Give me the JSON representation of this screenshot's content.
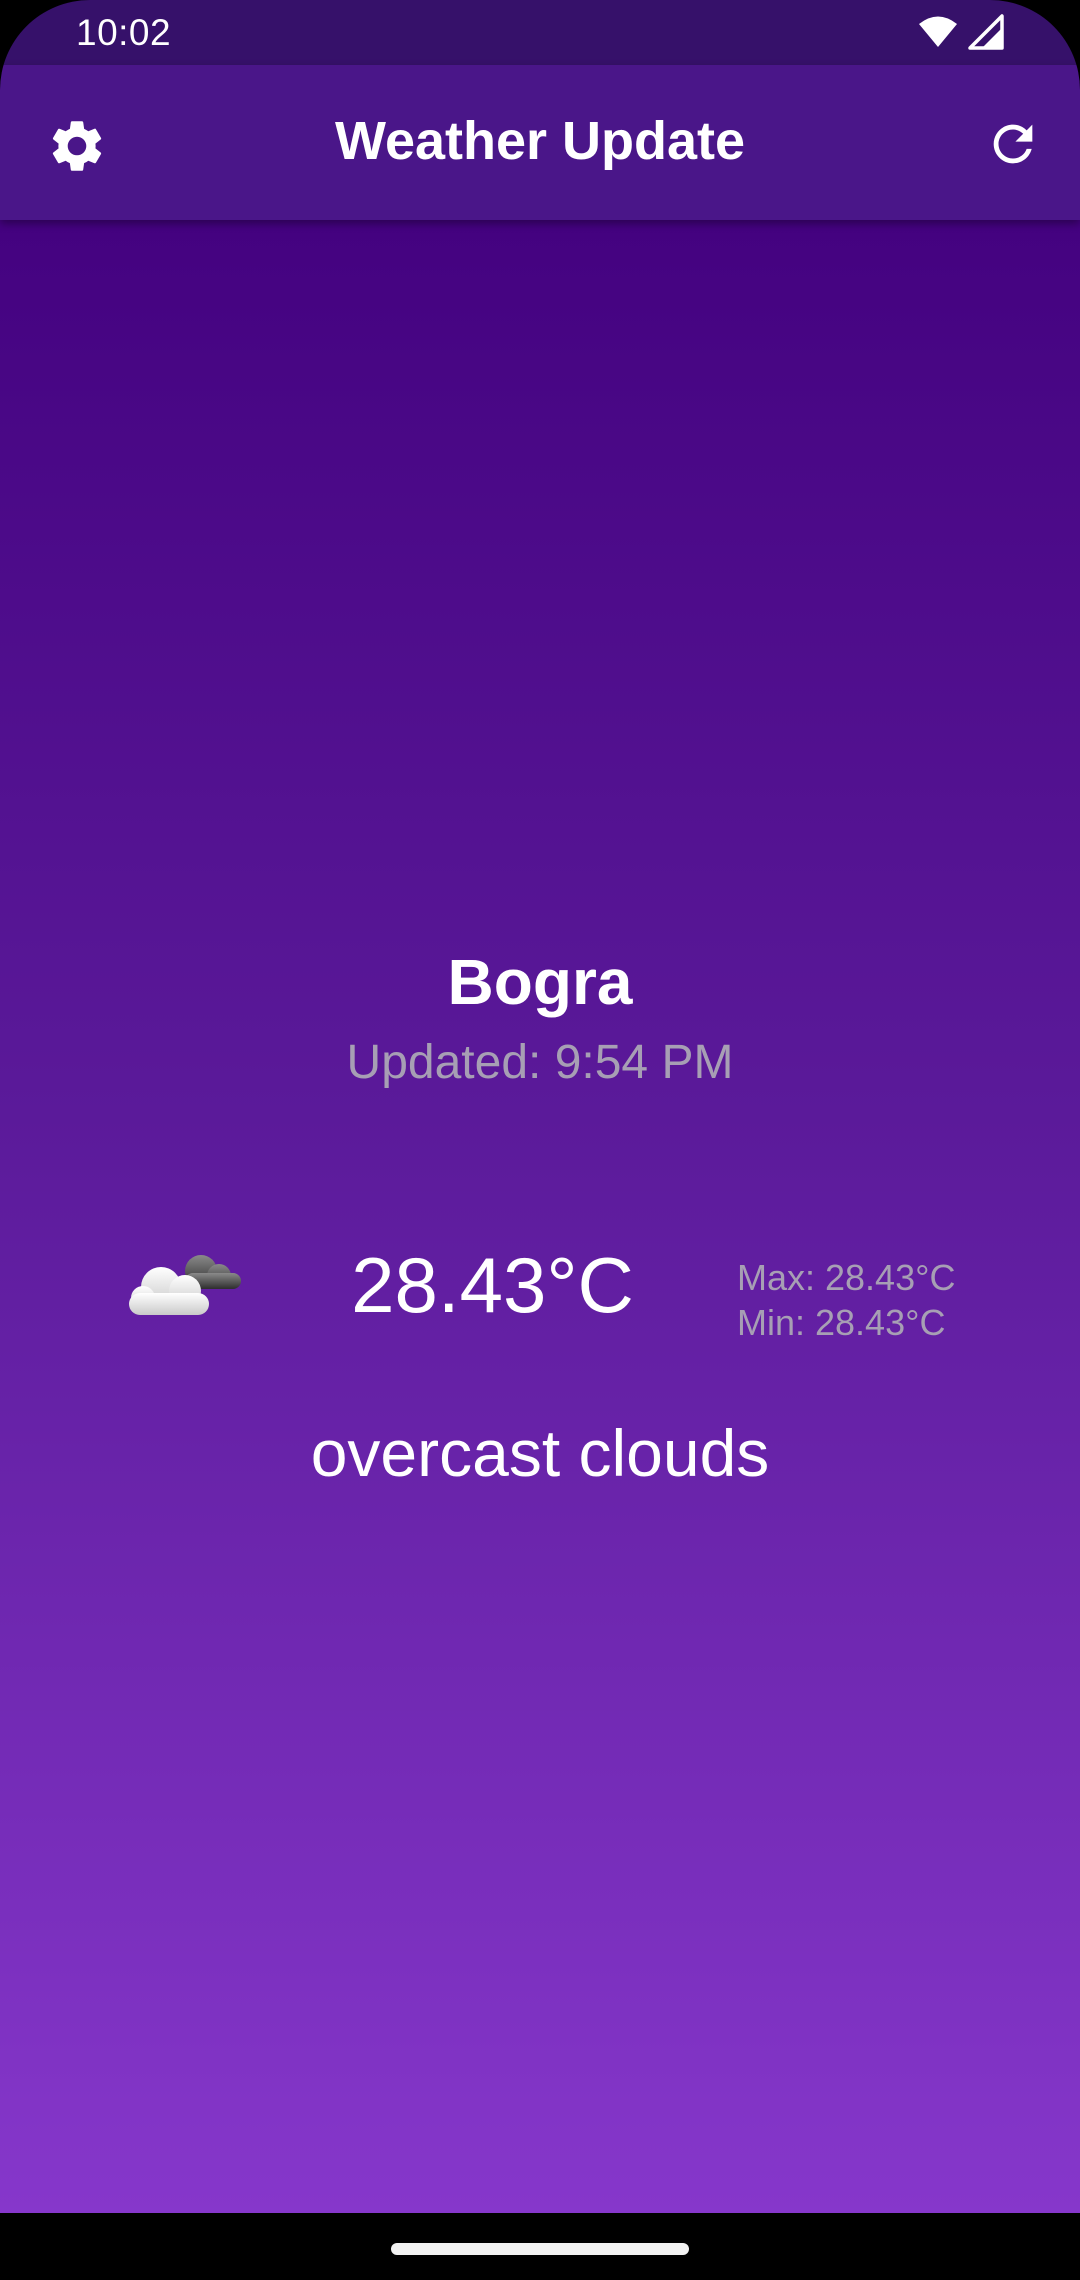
{
  "status_bar": {
    "time": "10:02",
    "wifi_icon": "wifi-icon",
    "signal_icon": "cell-signal-icon"
  },
  "app_bar": {
    "title": "Weather Update",
    "settings_icon": "gear-icon",
    "refresh_icon": "refresh-icon",
    "color": "#4a1689"
  },
  "weather": {
    "city": "Bogra",
    "updated": "Updated: 9:54 PM",
    "icon": "overcast-clouds-icon",
    "temperature": "28.43°C",
    "max": "Max: 28.43°C",
    "min": "Min: 28.43°C",
    "description": "overcast clouds"
  },
  "theme": {
    "gradient_top": "#440280",
    "gradient_bottom": "#8637cb",
    "secondary_text": "#a79fb4"
  }
}
